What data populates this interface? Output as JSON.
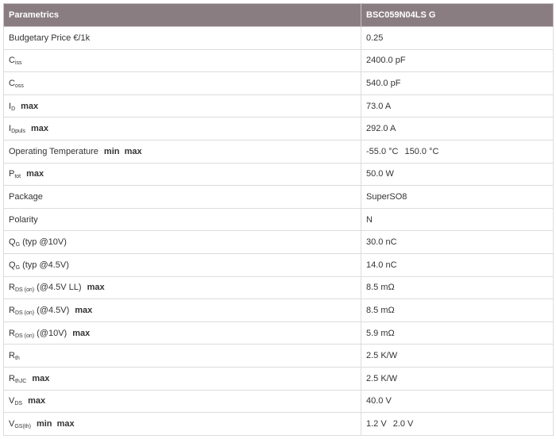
{
  "header": {
    "col1": "Parametrics",
    "col2": "BSC059N04LS G"
  },
  "rows": [
    {
      "name": "Budgetary Price €/1k",
      "value": "0.25"
    },
    {
      "name": "C",
      "sub": "iss",
      "value": "2400.0 pF"
    },
    {
      "name": "C",
      "sub": "oss",
      "value": "540.0 pF"
    },
    {
      "name": "I",
      "sub": "D",
      "qual": "max",
      "value": "73.0 A"
    },
    {
      "name": "I",
      "sub": "Dpuls",
      "qual": "max",
      "value": "292.0 A"
    },
    {
      "name": "Operating Temperature",
      "qual": "min  max",
      "value": "-55.0 °C",
      "value2": "150.0 °C"
    },
    {
      "name": "P",
      "sub": "tot",
      "qual": "max",
      "value": "50.0 W"
    },
    {
      "name": "Package",
      "value": "SuperSO8"
    },
    {
      "name": "Polarity",
      "value": "N"
    },
    {
      "name": "Q",
      "sub": "G",
      "suffix": "(typ @10V)",
      "value": "30.0 nC"
    },
    {
      "name": "Q",
      "sub": "G",
      "suffix": "(typ @4.5V)",
      "value": "14.0 nC"
    },
    {
      "name": "R",
      "sub": "DS (on)",
      "suffix": "(@4.5V LL)",
      "qual": "max",
      "value": "8.5 mΩ"
    },
    {
      "name": "R",
      "sub": "DS (on)",
      "suffix": "(@4.5V)",
      "qual": "max",
      "value": "8.5 mΩ"
    },
    {
      "name": "R",
      "sub": "DS (on)",
      "suffix": "(@10V)",
      "qual": "max",
      "value": "5.9 mΩ"
    },
    {
      "name": "R",
      "sub": "th",
      "value": "2.5 K/W"
    },
    {
      "name": "R",
      "sub": "thJC",
      "qual": "max",
      "value": "2.5 K/W"
    },
    {
      "name": "V",
      "sub": "DS",
      "qual": "max",
      "value": "40.0 V"
    },
    {
      "name": "V",
      "sub": "GS(th)",
      "qual": "min  max",
      "value": "1.2 V",
      "value2": "2.0 V"
    }
  ]
}
